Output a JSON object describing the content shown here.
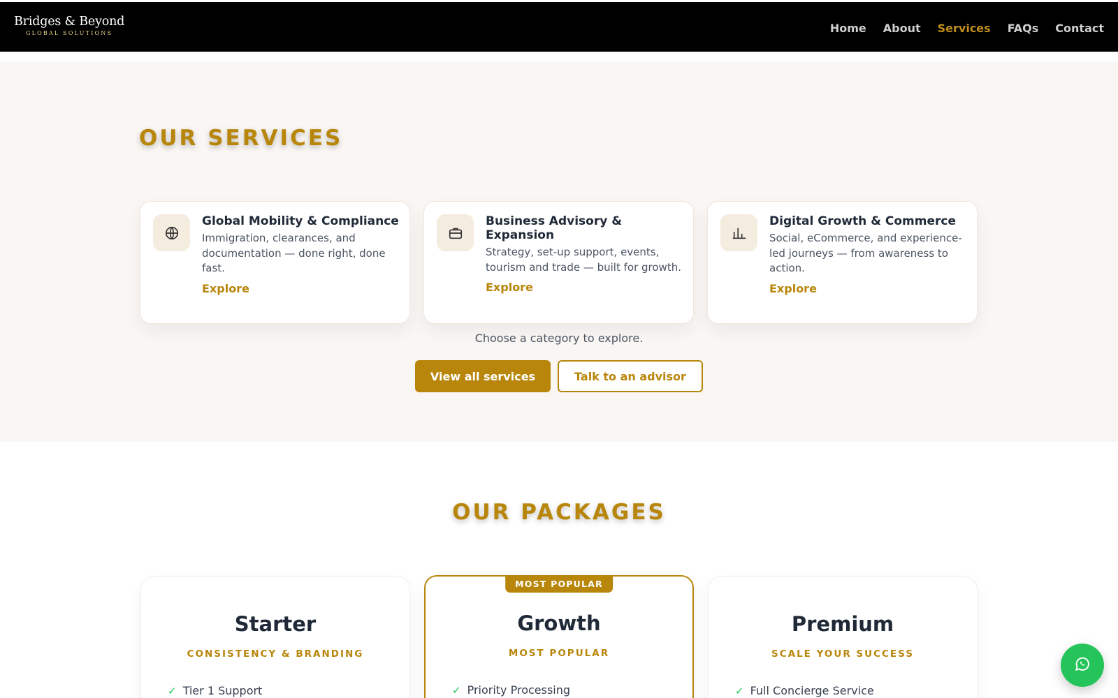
{
  "header": {
    "logo_main": "Bridges & Beyond",
    "logo_sub": "GLOBAL SOLUTIONS",
    "nav": [
      {
        "label": "Home"
      },
      {
        "label": "About"
      },
      {
        "label": "Services",
        "active": true
      },
      {
        "label": "FAQs"
      },
      {
        "label": "Contact"
      }
    ]
  },
  "services": {
    "title": "OUR SERVICES",
    "cards": [
      {
        "title": "Global Mobility & Compliance",
        "description": "Immigration, clearances, and documentation — done right, done fast.",
        "link": "Explore",
        "icon": "globe-icon"
      },
      {
        "title": "Business Advisory & Expansion",
        "description": "Strategy, set-up support, events, tourism and trade — built for growth.",
        "link": "Explore",
        "icon": "briefcase-icon"
      },
      {
        "title": "Digital Growth & Commerce",
        "description": "Social, eCommerce, and experience-led journeys — from awareness to action.",
        "link": "Explore",
        "icon": "chart-icon"
      }
    ],
    "hint": "Choose a category to explore.",
    "primary_button": "View all services",
    "secondary_button": "Talk to an advisor"
  },
  "packages": {
    "title": "OUR PACKAGES",
    "cards": [
      {
        "name": "Starter",
        "tagline": "CONSISTENCY & BRANDING",
        "feature": "Tier 1 Support"
      },
      {
        "name": "Growth",
        "tagline": "MOST POPULAR",
        "feature": "Priority Processing",
        "badge": "MOST POPULAR"
      },
      {
        "name": "Premium",
        "tagline": "SCALE YOUR SUCCESS",
        "feature": "Full Concierge Service"
      }
    ]
  },
  "colors": {
    "accent": "#b8860b",
    "header_bg": "#000000",
    "section_bg": "#f9f6f3",
    "whatsapp": "#25c45a"
  },
  "chat_button_icon": "whatsapp-icon"
}
